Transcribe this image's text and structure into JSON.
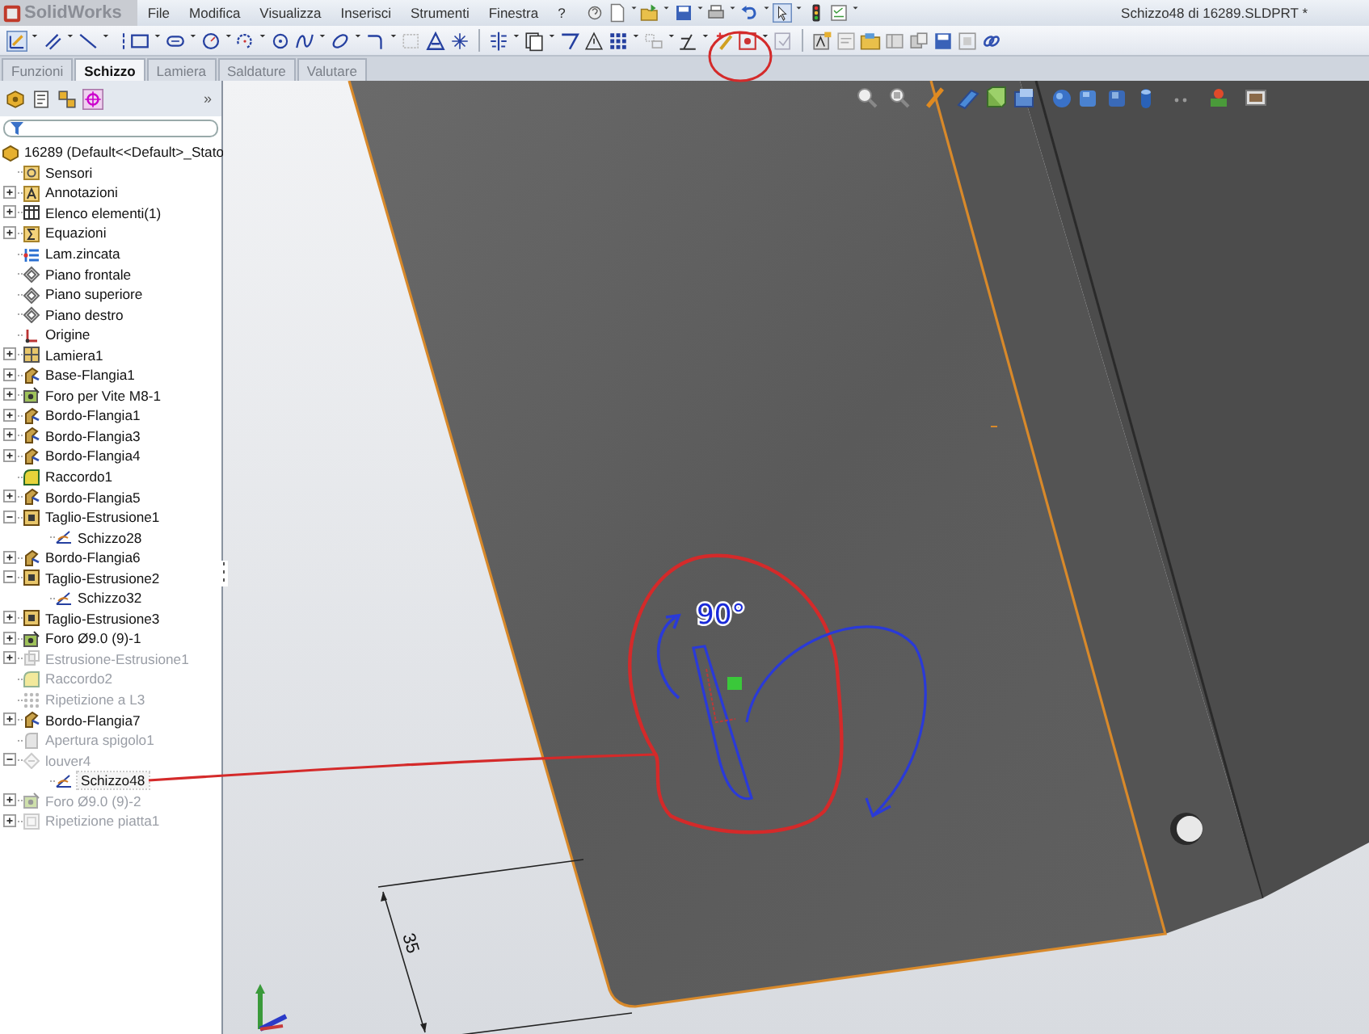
{
  "app": {
    "logo": "SolidWorks",
    "title": "Schizzo48 di 16289.SLDPRT *"
  },
  "menu": [
    "File",
    "Modifica",
    "Visualizza",
    "Inserisci",
    "Strumenti",
    "Finestra",
    "?"
  ],
  "tabs": [
    {
      "label": "Funzioni",
      "selected": false
    },
    {
      "label": "Schizzo",
      "selected": true
    },
    {
      "label": "Lamiera",
      "selected": false
    },
    {
      "label": "Saldature",
      "selected": false
    },
    {
      "label": "Valutare",
      "selected": false
    }
  ],
  "panel": {
    "more": "»"
  },
  "tree": {
    "label": "16289  (Default<<Default>_Stato",
    "children": [
      {
        "label": "Sensori",
        "kind": "sensor",
        "suppressed": false,
        "selected": false
      },
      {
        "label": "Annotazioni",
        "kind": "annotation",
        "suppressed": false,
        "selected": false,
        "expanded": false
      },
      {
        "label": "Elenco elementi(1)",
        "kind": "list",
        "suppressed": false,
        "selected": false,
        "expanded": false
      },
      {
        "label": "Equazioni",
        "kind": "equation",
        "suppressed": false,
        "selected": false,
        "expanded": false
      },
      {
        "label": "Lam.zincata",
        "kind": "material",
        "suppressed": false,
        "selected": false
      },
      {
        "label": "Piano frontale",
        "kind": "plane",
        "suppressed": false,
        "selected": false
      },
      {
        "label": "Piano superiore",
        "kind": "plane",
        "suppressed": false,
        "selected": false
      },
      {
        "label": "Piano destro",
        "kind": "plane",
        "suppressed": false,
        "selected": false
      },
      {
        "label": "Origine",
        "kind": "origin",
        "suppressed": false,
        "selected": false
      },
      {
        "label": "Lamiera1",
        "kind": "sheet",
        "suppressed": false,
        "selected": false,
        "expanded": false
      },
      {
        "label": "Base-Flangia1",
        "kind": "flange",
        "suppressed": false,
        "selected": false,
        "expanded": false
      },
      {
        "label": "Foro per Vite M8-1",
        "kind": "hole",
        "suppressed": false,
        "selected": false,
        "expanded": false
      },
      {
        "label": "Bordo-Flangia1",
        "kind": "flange",
        "suppressed": false,
        "selected": false,
        "expanded": false
      },
      {
        "label": "Bordo-Flangia3",
        "kind": "flange",
        "suppressed": false,
        "selected": false,
        "expanded": false
      },
      {
        "label": "Bordo-Flangia4",
        "kind": "flange",
        "suppressed": false,
        "selected": false,
        "expanded": false
      },
      {
        "label": "Raccordo1",
        "kind": "fillet",
        "suppressed": false,
        "selected": false
      },
      {
        "label": "Bordo-Flangia5",
        "kind": "flange",
        "suppressed": false,
        "selected": false,
        "expanded": false
      },
      {
        "label": "Taglio-Estrusione1",
        "kind": "cut",
        "suppressed": false,
        "selected": false,
        "expanded": true,
        "children": [
          {
            "label": "Schizzo28",
            "kind": "sketch",
            "suppressed": false,
            "selected": false
          }
        ]
      },
      {
        "label": "Bordo-Flangia6",
        "kind": "flange",
        "suppressed": false,
        "selected": false,
        "expanded": false
      },
      {
        "label": "Taglio-Estrusione2",
        "kind": "cut",
        "suppressed": false,
        "selected": false,
        "expanded": true,
        "children": [
          {
            "label": "Schizzo32",
            "kind": "sketch",
            "suppressed": false,
            "selected": false
          }
        ]
      },
      {
        "label": "Taglio-Estrusione3",
        "kind": "cut",
        "suppressed": false,
        "selected": false,
        "expanded": false
      },
      {
        "label": "Foro Ø9.0 (9)-1",
        "kind": "hole",
        "suppressed": false,
        "selected": false,
        "expanded": false
      },
      {
        "label": "Estrusione-Estrusione1",
        "kind": "extrude",
        "suppressed": true,
        "selected": false,
        "expanded": false
      },
      {
        "label": "Raccordo2",
        "kind": "fillet",
        "suppressed": true,
        "selected": false
      },
      {
        "label": "Ripetizione a L3",
        "kind": "pattern",
        "suppressed": true,
        "selected": false
      },
      {
        "label": "Bordo-Flangia7",
        "kind": "flange",
        "suppressed": false,
        "selected": false,
        "expanded": false
      },
      {
        "label": "Apertura spigolo1",
        "kind": "corner",
        "suppressed": true,
        "selected": false
      },
      {
        "label": "louver4",
        "kind": "louver",
        "suppressed": true,
        "selected": false,
        "expanded": true,
        "children": [
          {
            "label": "Schizzo48",
            "kind": "sketch",
            "suppressed": false,
            "selected": true
          }
        ]
      },
      {
        "label": "Foro Ø9.0 (9)-2",
        "kind": "hole",
        "suppressed": true,
        "selected": false,
        "expanded": false
      },
      {
        "label": "Ripetizione piatta1",
        "kind": "flatpattern",
        "suppressed": true,
        "selected": false,
        "expanded": false
      }
    ]
  },
  "viewport": {
    "dimension": "35",
    "note": "90°"
  }
}
